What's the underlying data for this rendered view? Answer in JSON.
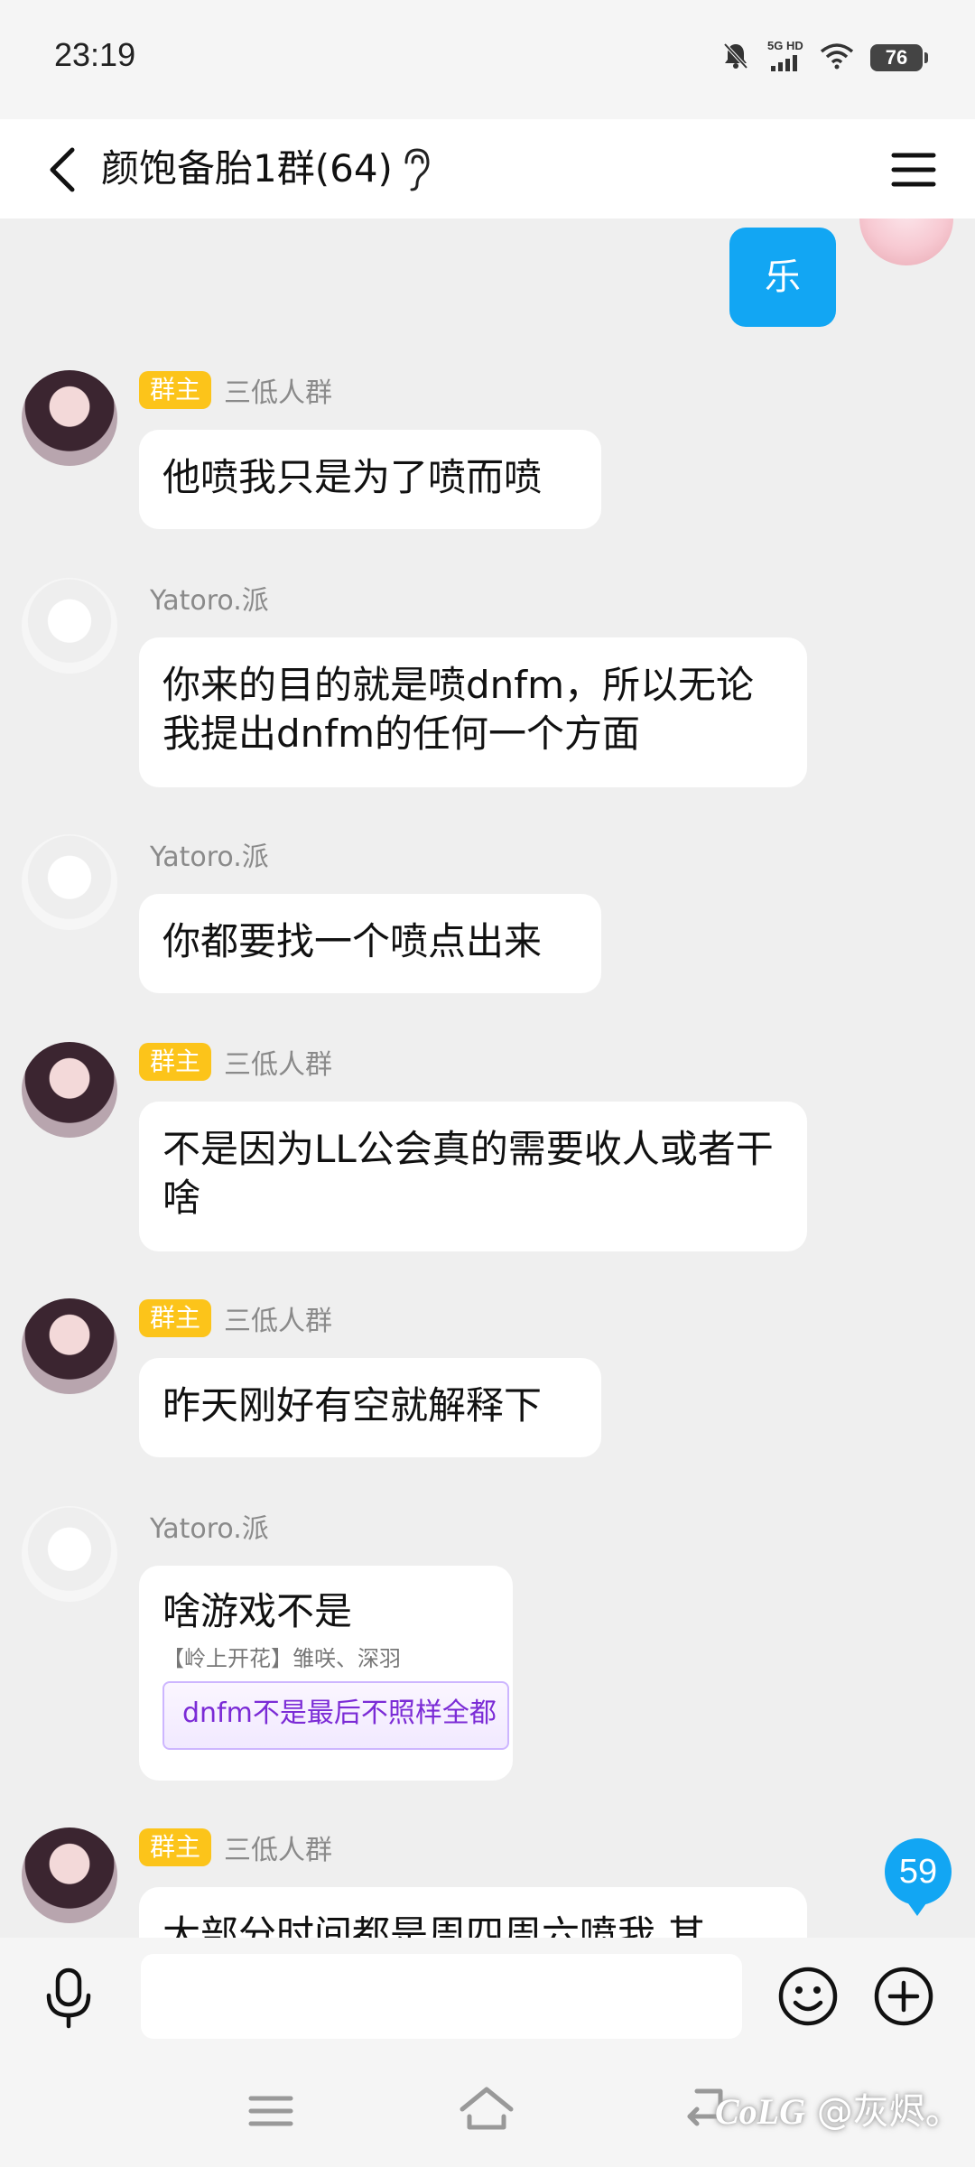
{
  "status_bar": {
    "time": "23:19",
    "network": "5G HD",
    "battery": "76"
  },
  "header": {
    "title": "颜饱备胎1群(64)"
  },
  "self_message": {
    "text": "乐"
  },
  "messages": [
    {
      "sender": "三低人群",
      "badge": "群主",
      "text": "他喷我只是为了喷而喷"
    },
    {
      "sender": "Yatoro.派",
      "text": "你来的目的就是喷dnfm，所以无论我提出dnfm的任何一个方面"
    },
    {
      "sender": "Yatoro.派",
      "text": "你都要找一个喷点出来"
    },
    {
      "sender": "三低人群",
      "badge": "群主",
      "text": "不是因为LL公会真的需要收人或者干啥"
    },
    {
      "sender": "三低人群",
      "badge": "群主",
      "text": "昨天刚好有空就解释下"
    },
    {
      "sender": "Yatoro.派",
      "text": "啥游戏不是",
      "quote_author": "【岭上开花】雏咲、深羽",
      "quote_text": "dnfm不是最后不照样全都"
    },
    {
      "sender": "三低人群",
      "badge": "群主",
      "text": "大部分时间都是周四周六喷我 其"
    }
  ],
  "unread_count": "59",
  "input": {
    "placeholder": ""
  },
  "watermark": "@灰烬。",
  "watermark_logo": "CoLG",
  "icons": {
    "back": "chevron-left-icon",
    "ear": "ear-icon",
    "menu": "menu-icon",
    "mic": "microphone-icon",
    "emoji": "emoji-icon",
    "plus": "plus-circle-icon"
  },
  "colors": {
    "accent": "#12a6f3",
    "owner_badge": "#fcc41a",
    "background": "#efefef"
  }
}
